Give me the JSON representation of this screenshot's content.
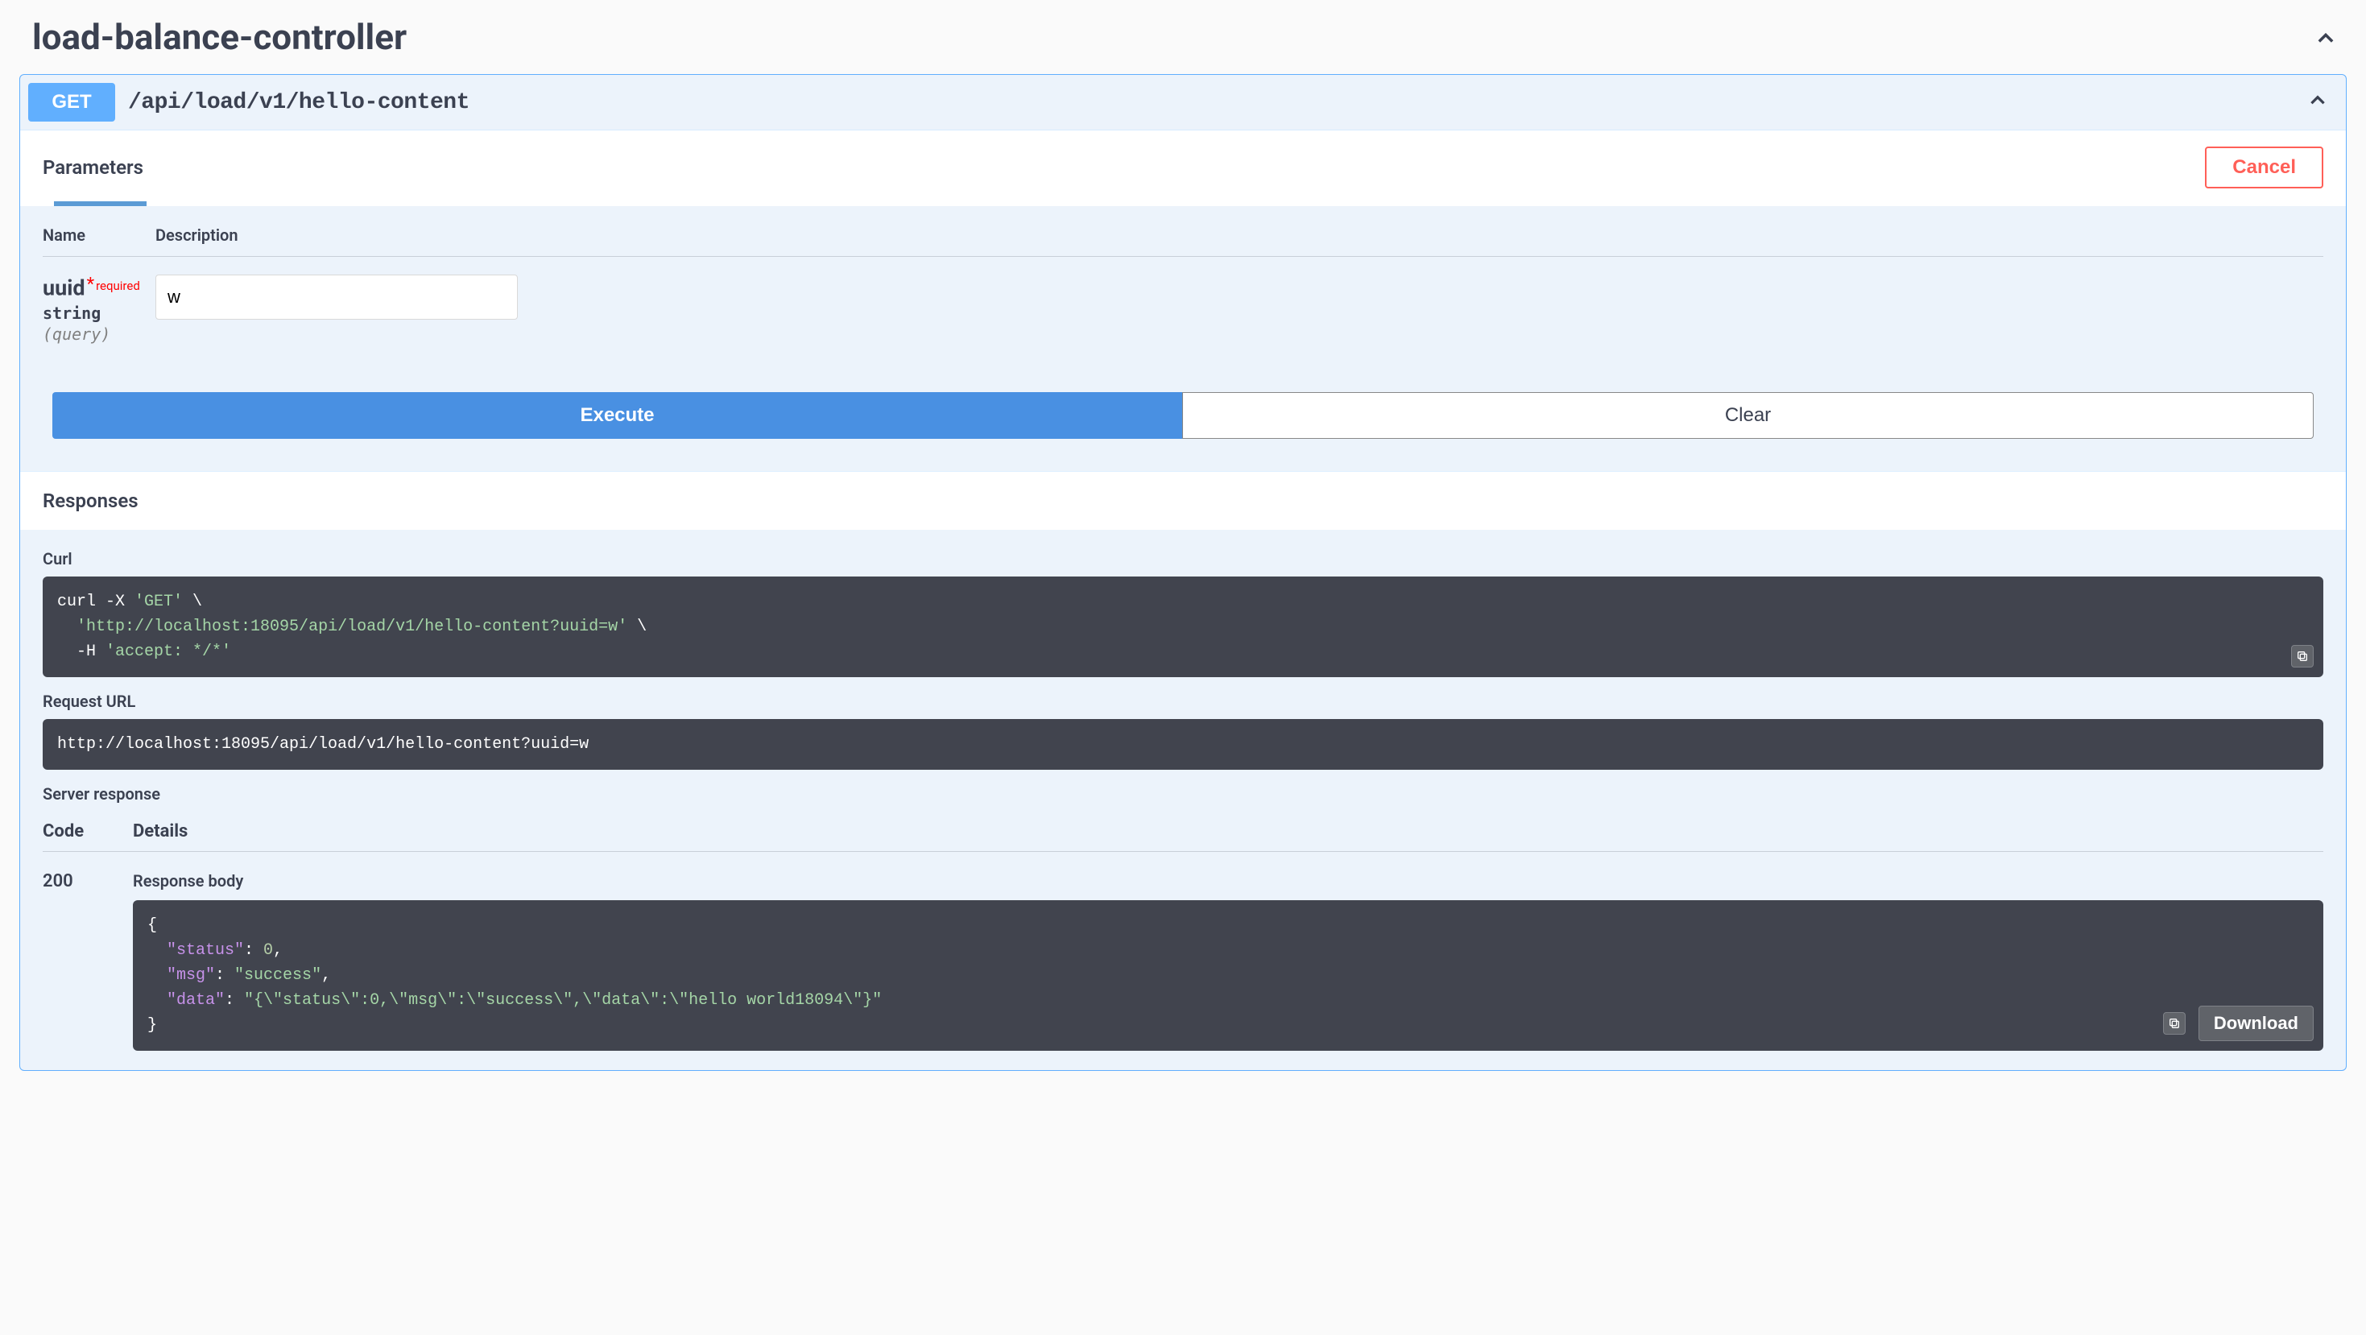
{
  "section": {
    "title": "load-balance-controller"
  },
  "op": {
    "method": "GET",
    "path": "/api/load/v1/hello-content"
  },
  "params": {
    "header": "Parameters",
    "cancel": "Cancel",
    "cols": {
      "name": "Name",
      "desc": "Description"
    },
    "p0": {
      "name": "uuid",
      "required": "required",
      "type": "string",
      "in": "(query)",
      "value": "w"
    }
  },
  "buttons": {
    "execute": "Execute",
    "clear": "Clear",
    "download": "Download"
  },
  "responses": {
    "header": "Responses",
    "curl_label": "Curl",
    "curl": {
      "l1a": "curl -X ",
      "l1b": "'GET'",
      "l1c": " \\",
      "l2a": "  ",
      "l2b": "'http://localhost:18095/api/load/v1/hello-content?uuid=w'",
      "l2c": " \\",
      "l3a": "  -H ",
      "l3b": "'accept: */*'"
    },
    "request_url_label": "Request URL",
    "request_url": "http://localhost:18095/api/load/v1/hello-content?uuid=w",
    "server_response_label": "Server response",
    "cols": {
      "code": "Code",
      "details": "Details"
    },
    "status": "200",
    "response_body_label": "Response body",
    "body": {
      "open": "{",
      "k1": "\"status\"",
      "c1": ": ",
      "v1": "0",
      "t1": ",",
      "k2": "\"msg\"",
      "c2": ": ",
      "v2": "\"success\"",
      "t2": ",",
      "k3": "\"data\"",
      "c3": ": ",
      "v3": "\"{\\\"status\\\":0,\\\"msg\\\":\\\"success\\\",\\\"data\\\":\\\"hello world18094\\\"}\"",
      "close": "}"
    }
  }
}
